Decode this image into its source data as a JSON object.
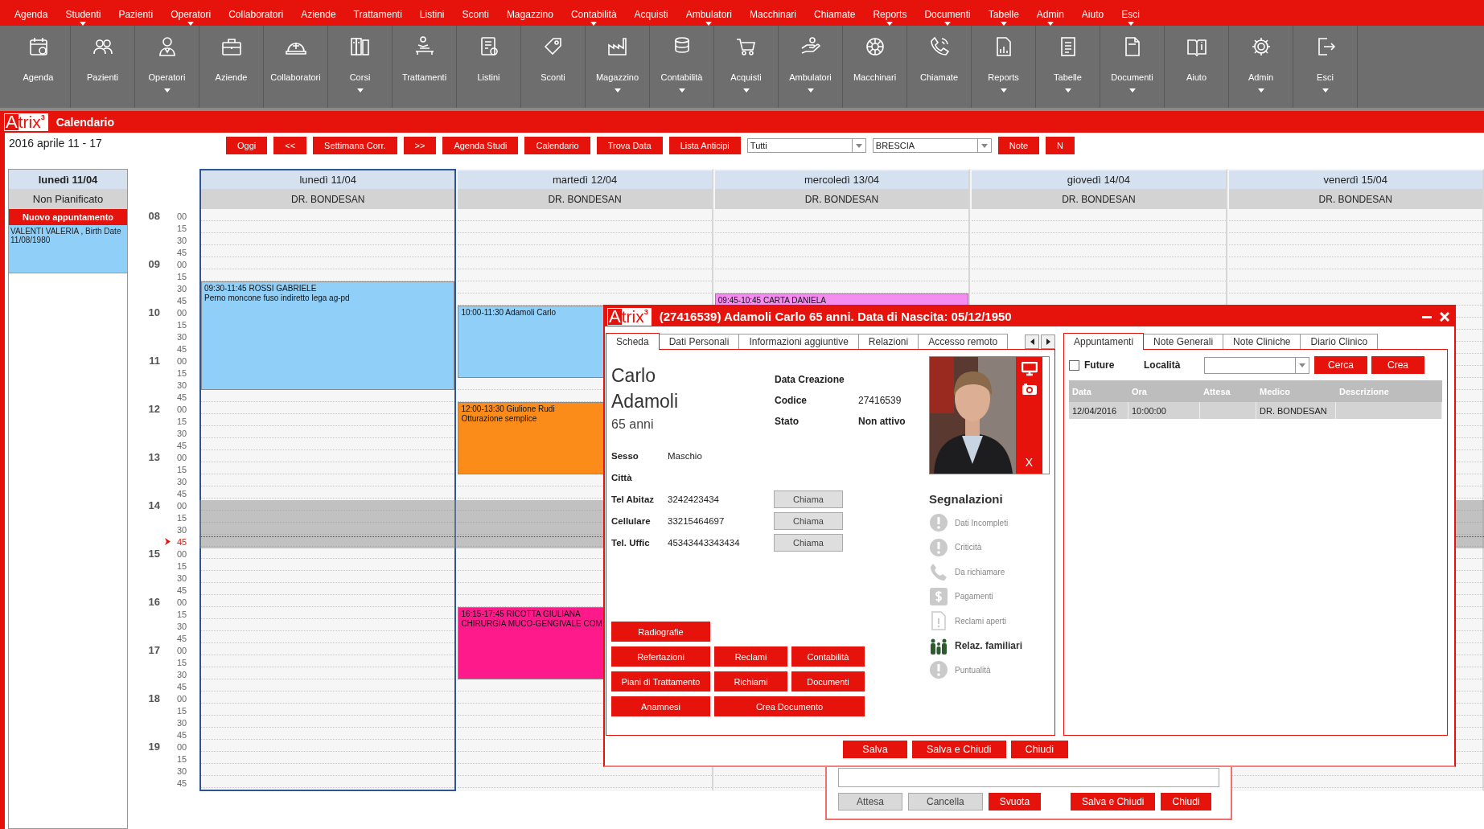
{
  "menu": [
    {
      "label": "Agenda",
      "has_menu": false
    },
    {
      "label": "Studenti",
      "has_menu": true
    },
    {
      "label": "Pazienti",
      "has_menu": false
    },
    {
      "label": "Operatori",
      "has_menu": true
    },
    {
      "label": "Collaboratori",
      "has_menu": false
    },
    {
      "label": "Aziende",
      "has_menu": false
    },
    {
      "label": "Trattamenti",
      "has_menu": false
    },
    {
      "label": "Listini",
      "has_menu": false
    },
    {
      "label": "Sconti",
      "has_menu": false
    },
    {
      "label": "Magazzino",
      "has_menu": false
    },
    {
      "label": "Contabilità",
      "has_menu": true
    },
    {
      "label": "Acquisti",
      "has_menu": false
    },
    {
      "label": "Ambulatori",
      "has_menu": true
    },
    {
      "label": "Macchinari",
      "has_menu": false
    },
    {
      "label": "Chiamate",
      "has_menu": false
    },
    {
      "label": "Reports",
      "has_menu": true
    },
    {
      "label": "Documenti",
      "has_menu": true
    },
    {
      "label": "Tabelle",
      "has_menu": true
    },
    {
      "label": "Admin",
      "has_menu": true
    },
    {
      "label": "Aiuto",
      "has_menu": false
    },
    {
      "label": "Esci",
      "has_menu": true
    }
  ],
  "toolbar": [
    {
      "label": "Agenda",
      "has_menu": false
    },
    {
      "label": "Pazienti",
      "has_menu": false
    },
    {
      "label": "Operatori",
      "has_menu": true
    },
    {
      "label": "Aziende",
      "has_menu": false
    },
    {
      "label": "Collaboratori",
      "has_menu": false
    },
    {
      "label": "Corsi",
      "has_menu": true
    },
    {
      "label": "Trattamenti",
      "has_menu": false
    },
    {
      "label": "Listini",
      "has_menu": false
    },
    {
      "label": "Sconti",
      "has_menu": false
    },
    {
      "label": "Magazzino",
      "has_menu": true
    },
    {
      "label": "Contabilità",
      "has_menu": true
    },
    {
      "label": "Acquisti",
      "has_menu": true
    },
    {
      "label": "Ambulatori",
      "has_menu": true
    },
    {
      "label": "Macchinari",
      "has_menu": false
    },
    {
      "label": "Chiamate",
      "has_menu": false
    },
    {
      "label": "Reports",
      "has_menu": true
    },
    {
      "label": "Tabelle",
      "has_menu": true
    },
    {
      "label": "Documenti",
      "has_menu": true
    },
    {
      "label": "Aiuto",
      "has_menu": false
    },
    {
      "label": "Admin",
      "has_menu": true
    },
    {
      "label": "Esci",
      "has_menu": true
    }
  ],
  "header": {
    "logo": {
      "initial": "A",
      "rest": "trix",
      "sup": "3"
    },
    "title": "Calendario"
  },
  "date_range": "2016 aprile 11 - 17",
  "controls": [
    {
      "kind": "button",
      "label": "Oggi"
    },
    {
      "kind": "button",
      "label": "<<"
    },
    {
      "kind": "button",
      "label": "Settimana Corr."
    },
    {
      "kind": "button",
      "label": ">>"
    },
    {
      "kind": "button",
      "label": "Agenda Studi"
    },
    {
      "kind": "button",
      "label": "Calendario"
    },
    {
      "kind": "button",
      "label": "Trova Data"
    },
    {
      "kind": "button",
      "label": "Lista Anticipi"
    },
    {
      "kind": "dropdown",
      "label": "Tutti"
    },
    {
      "kind": "dropdown",
      "label": "BRESCIA"
    },
    {
      "kind": "button",
      "label": "Note"
    },
    {
      "kind": "button",
      "label": "N"
    }
  ],
  "unplanned": {
    "day": "lunedì 11/04",
    "heading": "Non Pianificato",
    "button": "Nuovo appuntamento",
    "entries": [
      "VALENTI VALERIA , Birth Date 11/08/1980"
    ]
  },
  "hours": [
    {
      "hour": "08",
      "blocked": false,
      "minutes": [
        {
          "label": "00",
          "current": false
        },
        {
          "label": "15",
          "current": false
        },
        {
          "label": "30",
          "current": false
        },
        {
          "label": "45",
          "current": false
        }
      ]
    },
    {
      "hour": "09",
      "blocked": false,
      "minutes": [
        {
          "label": "00",
          "current": false
        },
        {
          "label": "15",
          "current": false
        },
        {
          "label": "30",
          "current": false
        },
        {
          "label": "45",
          "current": false
        }
      ]
    },
    {
      "hour": "10",
      "blocked": false,
      "minutes": [
        {
          "label": "00",
          "current": false
        },
        {
          "label": "15",
          "current": false
        },
        {
          "label": "30",
          "current": false
        },
        {
          "label": "45",
          "current": false
        }
      ]
    },
    {
      "hour": "11",
      "blocked": false,
      "minutes": [
        {
          "label": "00",
          "current": false
        },
        {
          "label": "15",
          "current": false
        },
        {
          "label": "30",
          "current": false
        },
        {
          "label": "45",
          "current": false
        }
      ]
    },
    {
      "hour": "12",
      "blocked": false,
      "minutes": [
        {
          "label": "00",
          "current": false
        },
        {
          "label": "15",
          "current": false
        },
        {
          "label": "30",
          "current": false
        },
        {
          "label": "45",
          "current": false
        }
      ]
    },
    {
      "hour": "13",
      "blocked": false,
      "minutes": [
        {
          "label": "00",
          "current": false
        },
        {
          "label": "15",
          "current": false
        },
        {
          "label": "30",
          "current": false
        },
        {
          "label": "45",
          "current": false
        }
      ]
    },
    {
      "hour": "14",
      "blocked": true,
      "minutes": [
        {
          "label": "00",
          "current": false
        },
        {
          "label": "15",
          "current": false
        },
        {
          "label": "30",
          "current": false
        },
        {
          "label": "45",
          "current": true
        }
      ]
    },
    {
      "hour": "15",
      "blocked": false,
      "minutes": [
        {
          "label": "00",
          "current": false
        },
        {
          "label": "15",
          "current": false
        },
        {
          "label": "30",
          "current": false
        },
        {
          "label": "45",
          "current": false
        }
      ]
    },
    {
      "hour": "16",
      "blocked": false,
      "minutes": [
        {
          "label": "00",
          "current": false
        },
        {
          "label": "15",
          "current": false
        },
        {
          "label": "30",
          "current": false
        },
        {
          "label": "45",
          "current": false
        }
      ]
    },
    {
      "hour": "17",
      "blocked": false,
      "minutes": [
        {
          "label": "00",
          "current": false
        },
        {
          "label": "15",
          "current": false
        },
        {
          "label": "30",
          "current": false
        },
        {
          "label": "45",
          "current": false
        }
      ]
    },
    {
      "hour": "18",
      "blocked": false,
      "minutes": [
        {
          "label": "00",
          "current": false
        },
        {
          "label": "15",
          "current": false
        },
        {
          "label": "30",
          "current": false
        },
        {
          "label": "45",
          "current": false
        }
      ]
    },
    {
      "hour": "19",
      "blocked": false,
      "minutes": [
        {
          "label": "00",
          "current": false
        },
        {
          "label": "15",
          "current": false
        },
        {
          "label": "30",
          "current": false
        },
        {
          "label": "45",
          "current": false
        }
      ]
    }
  ],
  "days": [
    {
      "label": "lunedì 11/04",
      "doctor": "DR. BONDESAN",
      "selected": true,
      "appointments": [
        {
          "time": "09:30-11:45",
          "patient": "ROSSI GABRIELE",
          "note": "Perno moncone fuso indiretto lega ag-pd",
          "color": "#90cff8"
        }
      ]
    },
    {
      "label": "martedì 12/04",
      "doctor": "DR. BONDESAN",
      "selected": false,
      "appointments": [
        {
          "time": "10:00-11:30",
          "patient": "Adamoli Carlo",
          "color": "#90cff8"
        },
        {
          "time": "12:00-13:30",
          "patient": "Giulione Rudi",
          "note": "Otturazione semplice",
          "color": "#fb8c1a"
        },
        {
          "time": "16:15-17:45",
          "patient": "RICOTTA GIULIANA",
          "note": "CHIRURGIA MUCO-GENGIVALE COM",
          "color": "#fe1a8a"
        }
      ]
    },
    {
      "label": "mercoledì 13/04",
      "doctor": "DR. BONDESAN",
      "selected": false,
      "appointments": [
        {
          "time": "09:45-10:45",
          "patient": "CARTA DANIELA",
          "color": "#f58cf0"
        }
      ]
    },
    {
      "label": "giovedì 14/04",
      "doctor": "DR. BONDESAN",
      "selected": false
    },
    {
      "label": "venerdì 15/04",
      "doctor": "DR. BONDESAN",
      "selected": false
    }
  ],
  "back_dialog": {
    "buttons": [
      {
        "label": "Attesa",
        "kind": "secondary"
      },
      {
        "label": "Cancella",
        "kind": "secondary"
      },
      {
        "label": "Svuota",
        "kind": "primary"
      },
      {
        "label": "Salva e Chiudi",
        "kind": "primary"
      },
      {
        "label": "Chiudi",
        "kind": "primary"
      }
    ]
  },
  "patient_dialog": {
    "logo": {
      "initial": "A",
      "rest": "trix",
      "sup": "3"
    },
    "title": "(27416539) Adamoli Carlo 65 anni. Data di Nascita: 05/12/1950",
    "left_tabs": [
      {
        "label": "Scheda",
        "selected": true
      },
      {
        "label": "Dati Personali",
        "selected": false
      },
      {
        "label": "Informazioni aggiuntive",
        "selected": false
      },
      {
        "label": "Relazioni",
        "selected": false
      },
      {
        "label": "Accesso remoto",
        "selected": false
      }
    ],
    "first_name": "Carlo",
    "last_name": "Adamoli",
    "age": "65 anni",
    "info": [
      {
        "label": "Data Creazione",
        "kind": "date"
      },
      {
        "label": "Codice",
        "value": "27416539",
        "kind": "text"
      },
      {
        "label": "Stato",
        "value": "Non attivo",
        "kind": "status"
      }
    ],
    "photo_remove": "X",
    "fields": [
      {
        "label": "Sesso",
        "value": "Maschio"
      },
      {
        "label": "Città"
      },
      {
        "label": "Tel Abitaz",
        "value": "3242423434",
        "action": "Chiama"
      },
      {
        "label": "Cellulare",
        "value": "33215464697",
        "action": "Chiama"
      },
      {
        "label": "Tel. Uffic",
        "value": "45343443343434",
        "action": "Chiama"
      }
    ],
    "actions": [
      [
        "Radiografie"
      ],
      [
        "Refertazioni",
        "Reclami",
        "Contabilità"
      ],
      [
        "Piani di Trattamento",
        "Richiami",
        "Documenti"
      ],
      [
        "Anamnesi",
        "Crea Documento"
      ]
    ],
    "alerts_title": "Segnalazioni",
    "alerts": [
      {
        "kind": "alert",
        "label": "Dati Incompleti",
        "active": false
      },
      {
        "kind": "alert",
        "label": "Criticità",
        "active": false
      },
      {
        "kind": "phone",
        "label": "Da richiamare",
        "active": false
      },
      {
        "kind": "payment",
        "label": "Pagamenti",
        "active": false
      },
      {
        "kind": "document",
        "label": "Reclami aperti",
        "active": false
      },
      {
        "kind": "family",
        "label": "Relaz. familiari",
        "active": true
      },
      {
        "kind": "alert",
        "label": "Puntualità",
        "active": false
      }
    ],
    "right_tabs": [
      {
        "label": "Appuntamenti",
        "selected": true
      },
      {
        "label": "Note Generali",
        "selected": false
      },
      {
        "label": "Note Cliniche",
        "selected": false
      },
      {
        "label": "Diario Clinico",
        "selected": false
      }
    ],
    "future": {
      "label": "Future",
      "checked": false
    },
    "location_label": "Località",
    "search_button": "Cerca",
    "create_button": "Crea",
    "table": {
      "columns": [
        "Data",
        "Ora",
        "Attesa",
        "Medico",
        "Descrizione"
      ],
      "rows": [
        {
          "cells": [
            "12/04/2016",
            "10:00:00",
            null,
            "DR. BONDESAN",
            null
          ]
        }
      ]
    },
    "footer_buttons": [
      "Salva",
      "Salva e Chiudi",
      "Chiudi"
    ]
  }
}
